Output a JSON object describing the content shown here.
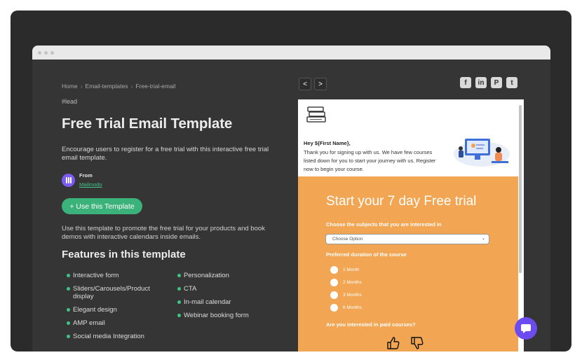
{
  "breadcrumb": {
    "items": [
      "Home",
      "Email-templates",
      "Free-trial-email"
    ],
    "separator": "›"
  },
  "tag": "#lead",
  "title": "Free Trial Email Template",
  "description": "Encourage users to register for a free trial with this interactive free trial email template.",
  "author": {
    "from_label": "From",
    "name": "Mailmodo"
  },
  "cta_label": "+ Use this Template",
  "usage_text": "Use this template to promote the free trial for your products and book demos with interactive calendars inside emails.",
  "features_title": "Features in this template",
  "features_left": [
    "Interactive form",
    "Sliders/Carousels/Product display",
    "Elegant design",
    "AMP email",
    "Social media Integration"
  ],
  "features_right": [
    "Personalization",
    "CTA",
    "In-mail calendar",
    "Webinar booking form"
  ],
  "nav": {
    "prev": "<",
    "next": ">"
  },
  "social_icons": [
    "facebook-icon",
    "linkedin-icon",
    "pinterest-icon",
    "twitter-icon"
  ],
  "email": {
    "greeting": "Hey ${First Name},",
    "body": "Thank you for signing up with us. We have few courses listed down for you to start your journey with us. Register now to begin your course.",
    "headline": "Start your 7 day Free trial",
    "q1": "Choose the subjects that you are interested in",
    "select_placeholder": "Choose Option",
    "q2": "Preferred duration of the course",
    "durations": [
      "1 Month",
      "2 Months",
      "3 Months",
      "6 Months"
    ],
    "q3": "Are you interested in paid courses?"
  },
  "colors": {
    "accent": "#3bb27a",
    "email_orange": "#f2a653",
    "chat": "#6c4cf0"
  }
}
